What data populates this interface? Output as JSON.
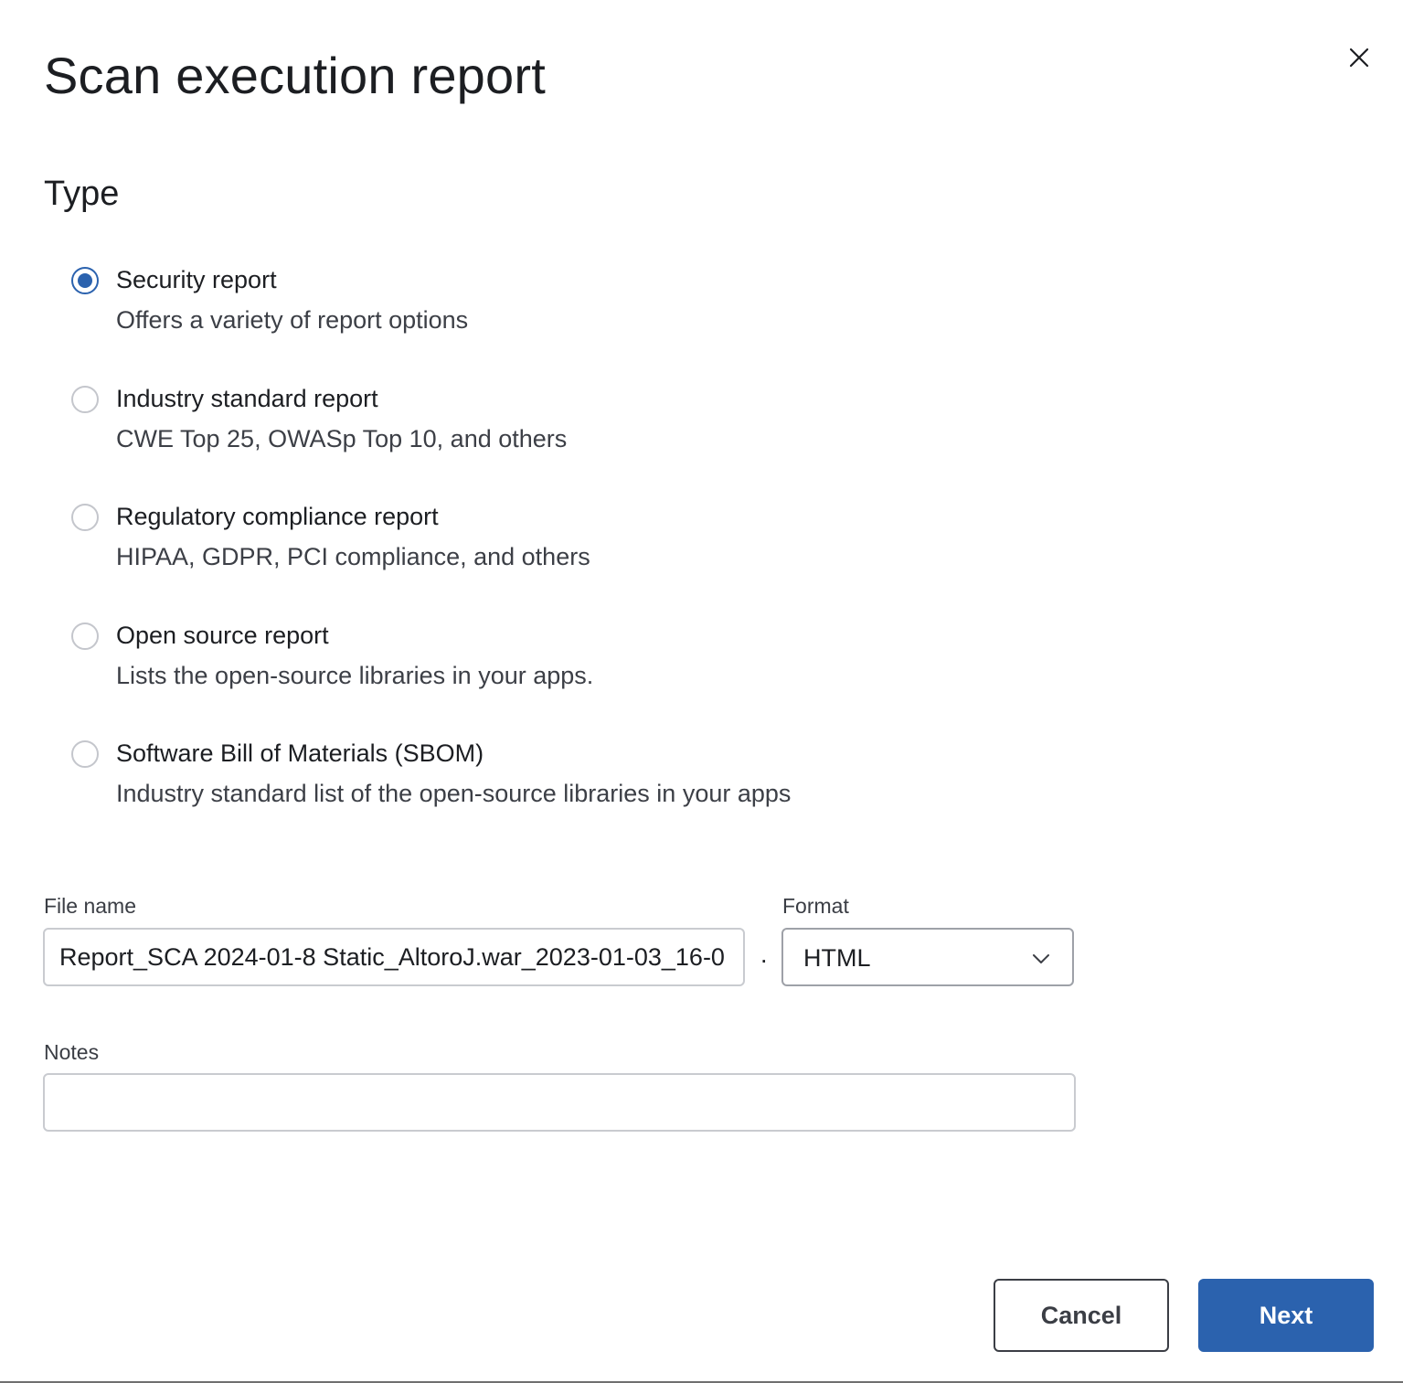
{
  "dialog": {
    "title": "Scan execution report",
    "close_icon": "close-icon"
  },
  "type_section": {
    "heading": "Type",
    "selected": "security",
    "options": [
      {
        "id": "security",
        "label": "Security report",
        "description": "Offers a variety of report options",
        "checked": true
      },
      {
        "id": "industry",
        "label": "Industry standard report",
        "description": "CWE Top 25, OWASp Top 10, and others",
        "checked": false
      },
      {
        "id": "regulatory",
        "label": "Regulatory compliance report",
        "description": "HIPAA, GDPR, PCI compliance, and others",
        "checked": false
      },
      {
        "id": "open-source",
        "label": "Open source report",
        "description": "Lists the open-source libraries in your apps.",
        "checked": false
      },
      {
        "id": "sbom",
        "label": "Software Bill of Materials (SBOM)",
        "description": "Industry standard list of the open-source libraries in your apps",
        "checked": false
      }
    ]
  },
  "file": {
    "label": "File name",
    "value": "Report_SCA 2024-01-8 Static_AltoroJ.war_2023-01-03_16-0",
    "separator": "."
  },
  "format": {
    "label": "Format",
    "value": "HTML",
    "icon": "chevron-down-icon"
  },
  "notes": {
    "label": "Notes",
    "value": ""
  },
  "actions": {
    "cancel_label": "Cancel",
    "next_label": "Next"
  },
  "colors": {
    "primary": "#2b62ae",
    "border": "#c9cbd0",
    "text": "#1c1e22"
  }
}
